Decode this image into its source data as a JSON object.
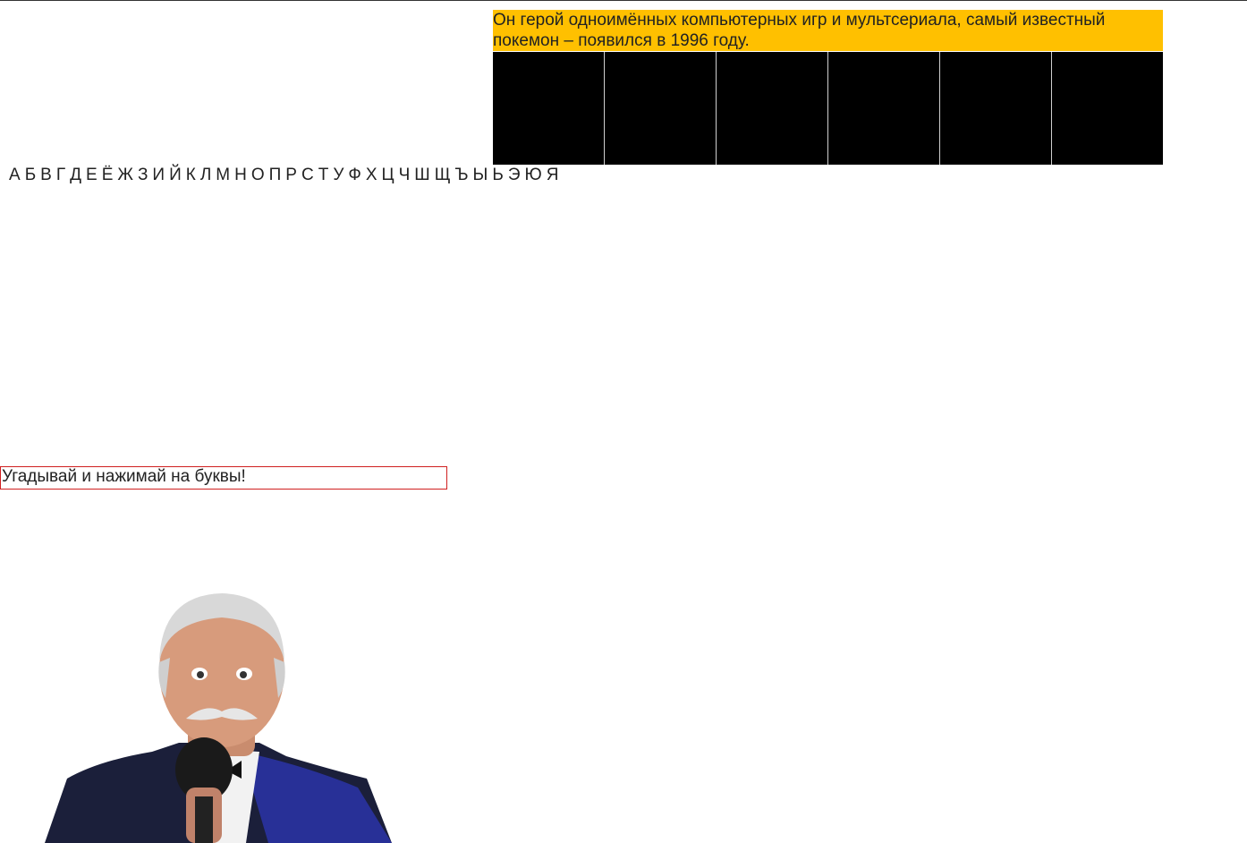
{
  "question": {
    "text": "Он герой одноимённых компьютерных игр и мультсериала, самый известный покемон – появился в 1996 году."
  },
  "word": {
    "cells": [
      "",
      "",
      "",
      "",
      "",
      ""
    ]
  },
  "alphabet": {
    "letters": [
      "А",
      "Б",
      "В",
      "Г",
      "Д",
      "Е",
      "Ё",
      "Ж",
      "З",
      "И",
      "Й",
      "К",
      "Л",
      "М",
      "Н",
      "О",
      "П",
      "Р",
      "С",
      "Т",
      "У",
      "Ф",
      "Х",
      "Ц",
      "Ч",
      "Ш",
      "Щ",
      "Ъ",
      "Ы",
      "Ь",
      "Э",
      "Ю",
      "Я"
    ]
  },
  "status": {
    "message": "Угадывай и нажимай на буквы!"
  },
  "colors": {
    "question_bg": "#ffc000",
    "cell_bg": "#000000",
    "status_border": "#d02020"
  }
}
